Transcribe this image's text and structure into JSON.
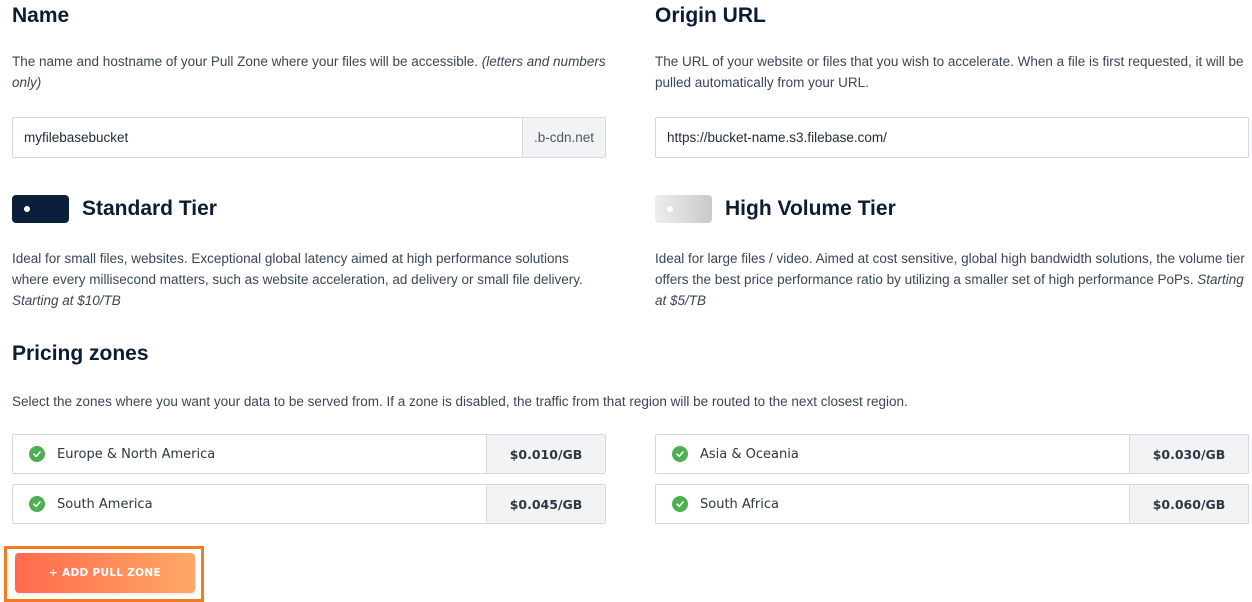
{
  "name_section": {
    "title": "Name",
    "description": "The name and hostname of your Pull Zone where your files will be accessible.",
    "description_note": "(letters and numbers only)",
    "input_value": "myfilebasebucket",
    "suffix": ".b-cdn.net"
  },
  "origin_section": {
    "title": "Origin URL",
    "description": "The URL of your website or files that you wish to accelerate. When a file is first requested, it will be pulled automatically from your URL.",
    "input_value": "https://bucket-name.s3.filebase.com/"
  },
  "standard_tier": {
    "title": "Standard Tier",
    "enabled": true,
    "description": "Ideal for small files, websites. Exceptional global latency aimed at high performance solutions where every millisecond matters, such as website acceleration, ad delivery or small file delivery.",
    "starting_price": "Starting at $10/TB"
  },
  "high_volume_tier": {
    "title": "High Volume Tier",
    "enabled": false,
    "description": "Ideal for large files / video. Aimed at cost sensitive, global high bandwidth solutions, the volume tier offers the best price performance ratio by utilizing a smaller set of high performance PoPs.",
    "starting_price": "Starting at $5/TB"
  },
  "pricing": {
    "title": "Pricing zones",
    "description": "Select the zones where you want your data to be served from. If a zone is disabled, the traffic from that region will be routed to the next closest region.",
    "zones": [
      {
        "name": "Europe & North America",
        "price": "$0.010/GB",
        "enabled": true
      },
      {
        "name": "Asia & Oceania",
        "price": "$0.030/GB",
        "enabled": true
      },
      {
        "name": "South America",
        "price": "$0.045/GB",
        "enabled": true
      },
      {
        "name": "South Africa",
        "price": "$0.060/GB",
        "enabled": true
      }
    ]
  },
  "actions": {
    "add_button_label": "+ ADD PULL ZONE"
  },
  "colors": {
    "toggle_on": "#0b1f3a",
    "check_green": "#4caf50",
    "button_start": "#ff6a4d",
    "button_end": "#ffa865",
    "highlight_frame": "#f47a1f"
  }
}
